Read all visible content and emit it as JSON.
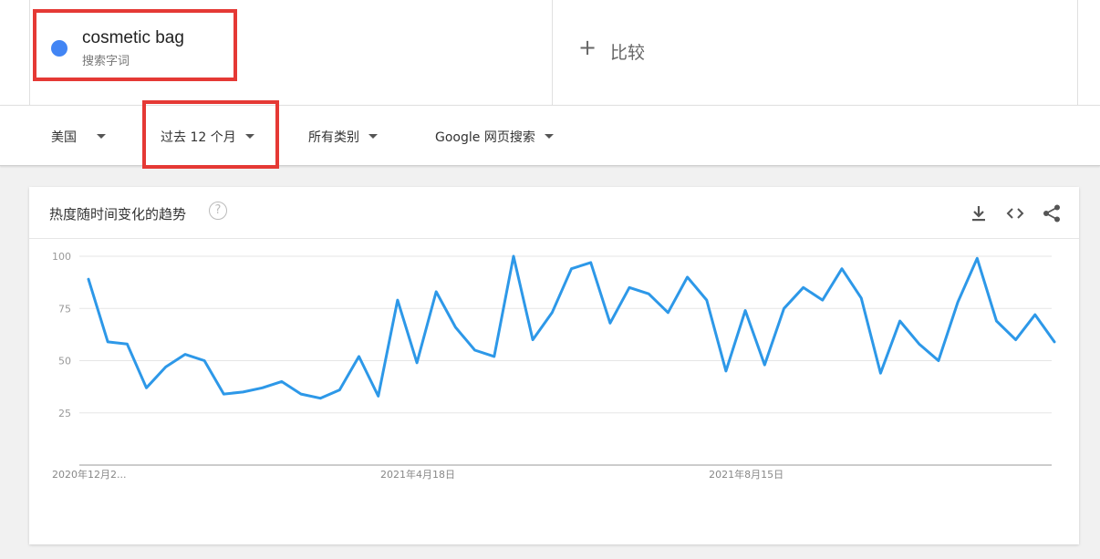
{
  "search_term": {
    "name": "cosmetic bag",
    "type": "搜索字词",
    "color": "#4285f4"
  },
  "compare": {
    "plus": "+",
    "label": "比较"
  },
  "filters": {
    "region": "美国",
    "time_range": "过去 12 个月",
    "category": "所有类别",
    "search_type": "Google 网页搜索"
  },
  "highlight_color": "#e53935",
  "panel": {
    "title": "热度随时间变化的趋势",
    "help_icon": "?",
    "icons": [
      "download-icon",
      "embed-icon",
      "share-icon"
    ]
  },
  "chart_data": {
    "type": "line",
    "title": "",
    "y_ticks": [
      25,
      50,
      75,
      100
    ],
    "ylim": [
      0,
      100
    ],
    "grid": true,
    "x_tick_labels": [
      {
        "index": 0,
        "label": "2020年12月2..."
      },
      {
        "index": 17,
        "label": "2021年4月18日"
      },
      {
        "index": 34,
        "label": "2021年8月15日"
      }
    ],
    "series": [
      {
        "color": "#2d98e8",
        "values": [
          89,
          59,
          58,
          37,
          47,
          53,
          50,
          34,
          35,
          37,
          40,
          34,
          32,
          36,
          52,
          33,
          79,
          49,
          83,
          66,
          55,
          52,
          100,
          60,
          73,
          94,
          97,
          68,
          85,
          82,
          73,
          90,
          79,
          45,
          74,
          48,
          75,
          85,
          79,
          94,
          80,
          44,
          69,
          58,
          50,
          78,
          99,
          69,
          60,
          72,
          59
        ]
      }
    ]
  }
}
